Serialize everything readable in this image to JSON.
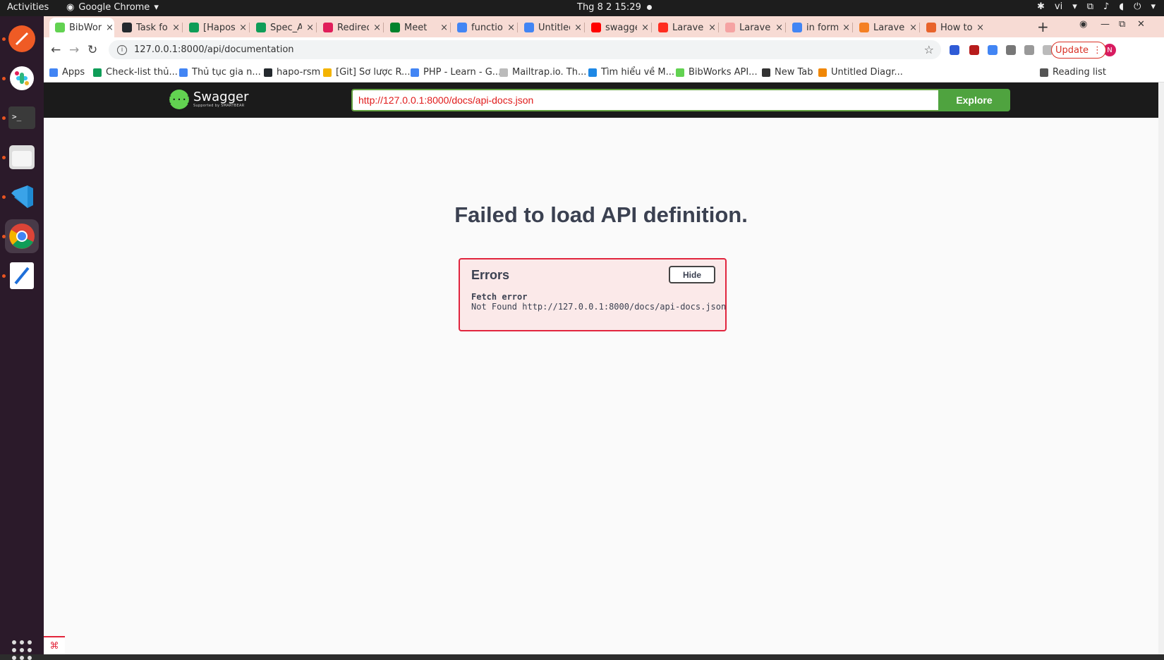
{
  "system": {
    "activities": "Activities",
    "app_name": "Google Chrome",
    "clock": "Thg 8 2  15:29",
    "lang": "vi"
  },
  "tabs": [
    {
      "label": "BibWorks",
      "color": "#62d251",
      "active": true
    },
    {
      "label": "Task for",
      "color": "#24292e"
    },
    {
      "label": "[Haposo",
      "color": "#0f9d58"
    },
    {
      "label": "Spec_Ap",
      "color": "#0f9d58"
    },
    {
      "label": "Redirect",
      "color": "#e01e5a"
    },
    {
      "label": "Meet",
      "color": "#00832d"
    },
    {
      "label": "function",
      "color": "#4285f4"
    },
    {
      "label": "Untitled",
      "color": "#4285f4"
    },
    {
      "label": "swagger",
      "color": "#ff0000"
    },
    {
      "label": "Laravel",
      "color": "#ff2d20"
    },
    {
      "label": "Laravel",
      "color": "#f5a3a3"
    },
    {
      "label": "in form",
      "color": "#4285f4"
    },
    {
      "label": "Laravel",
      "color": "#f48024"
    },
    {
      "label": "How to",
      "color": "#e8632b"
    }
  ],
  "toolbar": {
    "url": "127.0.0.1:8000/api/documentation",
    "update_label": "Update",
    "avatar_letter": "N"
  },
  "bookmarks": [
    {
      "label": "Apps",
      "color": "#4285f4"
    },
    {
      "label": "Check-list thủ...",
      "color": "#0f9d58"
    },
    {
      "label": "Thủ tục gia n...",
      "color": "#4285f4"
    },
    {
      "label": "hapo-rsm",
      "color": "#24292e"
    },
    {
      "label": "[Git] Sơ lược R...",
      "color": "#f4b400"
    },
    {
      "label": "PHP - Learn - G...",
      "color": "#4285f4"
    },
    {
      "label": "Mailtrap.io. Th...",
      "color": "#bbbbbb"
    },
    {
      "label": "Tìm hiểu về M...",
      "color": "#1e88e5"
    },
    {
      "label": "BibWorks API...",
      "color": "#62d251"
    },
    {
      "label": "New Tab",
      "color": "#333333"
    },
    {
      "label": "Untitled Diagr...",
      "color": "#f08705"
    },
    {
      "label": "Reading list",
      "color": "#555555"
    }
  ],
  "swagger": {
    "logo_text": "Swagger",
    "logo_sub": "Supported by SMARTBEAR",
    "url_value": "http://127.0.0.1:8000/docs/api-docs.json",
    "explore_label": "Explore",
    "fail_title": "Failed to load API definition.",
    "errors_title": "Errors",
    "hide_label": "Hide",
    "error_heading": "Fetch error",
    "error_message": "Not Found http://127.0.0.1:8000/docs/api-docs.json"
  }
}
